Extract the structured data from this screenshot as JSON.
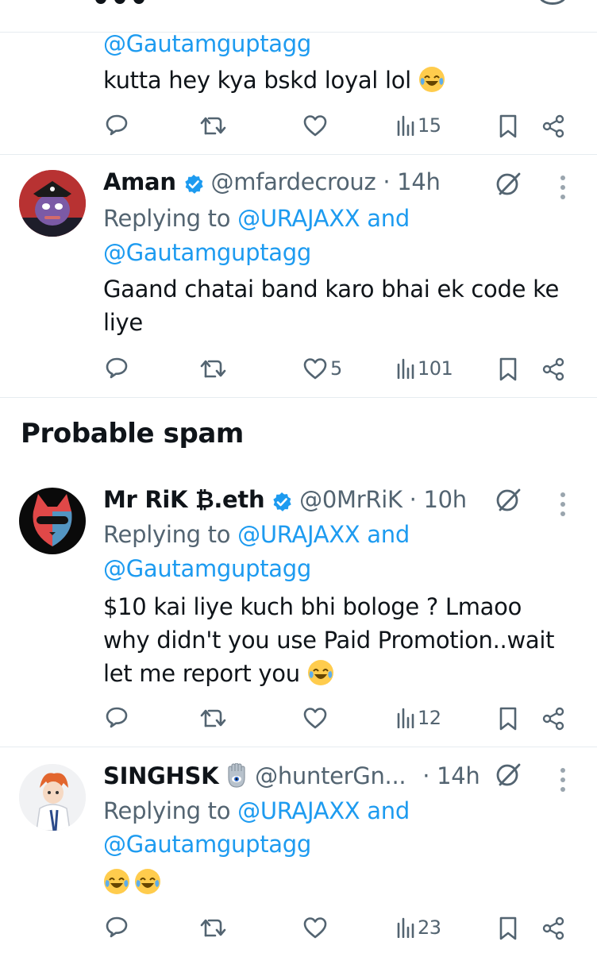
{
  "tweets": [
    {
      "reply_handle_line2": "@Gautamguptagg",
      "text_lines": [
        "kutta hey kya bskd loyal lol"
      ],
      "views": "15",
      "likes": "",
      "retweets": ""
    },
    {
      "name": "Aman",
      "handle": "@mfardecrouz",
      "time": "· 14h",
      "replying_prefix": "Replying to",
      "replying_to": "@URAJAXX and",
      "reply_handle_line2": "@Gautamguptagg",
      "text_lines": [
        "Gaand chatai band karo bhai ek code ke",
        "liye"
      ],
      "likes": "5",
      "views": "101"
    },
    {
      "name": "Mr RiK ₿.eth",
      "handle": "@0MrRiK",
      "time": "· 10h",
      "replying_prefix": "Replying to",
      "replying_to": "@URAJAXX and",
      "reply_handle_line2": "@Gautamguptagg",
      "text_lines": [
        "$10 kai liye kuch bhi bologe ? Lmaoo",
        "why didn't you use Paid Promotion..wait",
        "let me report you"
      ],
      "views": "12"
    },
    {
      "name": "SINGHSK",
      "handle": "@hunterGn...",
      "time": "· 14h",
      "replying_prefix": "Replying to",
      "replying_to": "@URAJAXX and",
      "reply_handle_line2": "@Gautamguptagg",
      "views": "23"
    }
  ],
  "section_title": "Probable spam",
  "colors": {
    "link": "#1d9bf0",
    "text": "#0f1419",
    "muted": "#536471",
    "verified": "#1d9bf0"
  }
}
